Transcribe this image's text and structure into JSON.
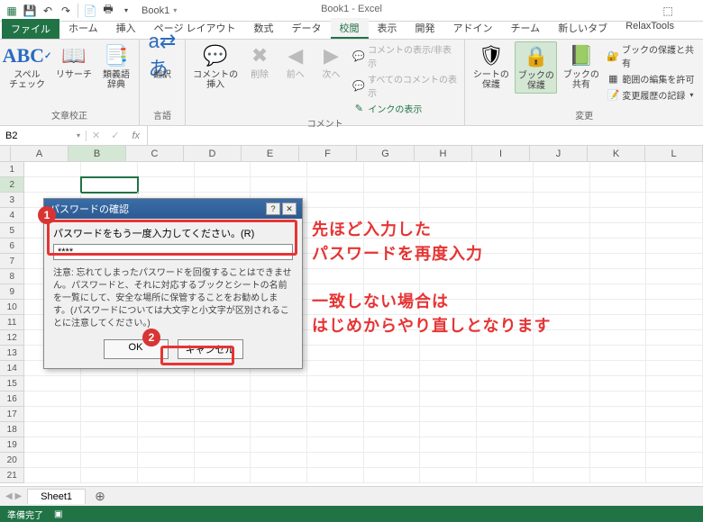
{
  "title": {
    "book_label": "Book1",
    "app_title": "Book1 - Excel"
  },
  "qat": {
    "icons": [
      "xl",
      "save",
      "undo",
      "redo",
      "sep",
      "new",
      "print",
      "down"
    ]
  },
  "tabs": {
    "file": "ファイル",
    "items": [
      "ホーム",
      "挿入",
      "ページ レイアウト",
      "数式",
      "データ",
      "校閲",
      "表示",
      "開発",
      "アドイン",
      "チーム",
      "新しいタブ",
      "RelaxTools"
    ],
    "active_index": 5
  },
  "ribbon": {
    "group1": {
      "label": "文章校正",
      "spell": "スペル\nチェック",
      "research": "リサーチ",
      "thesaurus": "類義語\n辞典"
    },
    "group2": {
      "label": "言語",
      "translate": "翻訳"
    },
    "group3": {
      "label": "コメント",
      "new_comment": "コメントの\n挿入",
      "delete": "削除",
      "prev": "前へ",
      "next": "次へ",
      "show_hide": "コメントの表示/非表示",
      "show_all": "すべてのコメントの表示",
      "ink": "インクの表示"
    },
    "group4": {
      "label": "変更",
      "protect_sheet": "シートの\n保護",
      "protect_book": "ブックの\n保護",
      "share": "ブックの\n共有",
      "share_protect": "ブックの保護と共有",
      "allow_ranges": "範囲の編集を許可",
      "track_changes": "変更履歴の記録"
    }
  },
  "namebox": "B2",
  "cols": [
    "A",
    "B",
    "C",
    "D",
    "E",
    "F",
    "G",
    "H",
    "I",
    "J",
    "K",
    "L"
  ],
  "selected_col": 1,
  "selected_row": 1,
  "row_count": 21,
  "sheet": {
    "name": "Sheet1"
  },
  "status": {
    "ready": "準備完了"
  },
  "dialog": {
    "title": "パスワードの確認",
    "label": "パスワードをもう一度入力してください。(R)",
    "value": "****",
    "note": "注意: 忘れてしまったパスワードを回復することはできません。パスワードと、それに対応するブックとシートの名前を一覧にして、安全な場所に保管することをお勧めします。(パスワードについては大文字と小文字が区別されることに注意してください。)",
    "ok": "OK",
    "cancel": "キャンセル"
  },
  "annotations": {
    "badge1": "1",
    "badge2": "2",
    "text1": "先ほど入力した\nパスワードを再度入力",
    "text2": "一致しない場合は\nはじめからやり直しとなります"
  }
}
